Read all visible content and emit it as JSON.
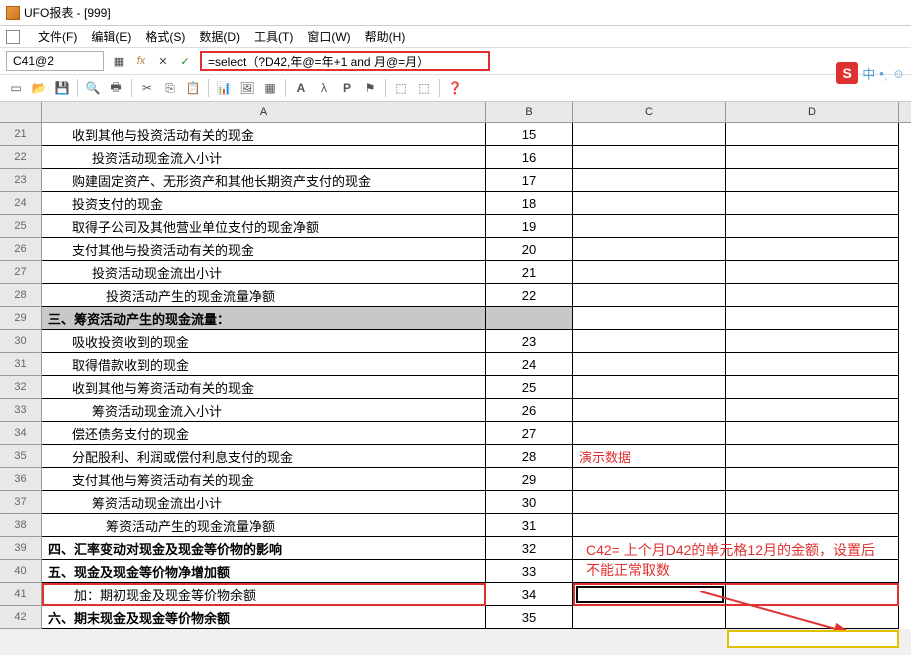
{
  "title": "UFO报表 - [999]",
  "menu": {
    "file": "文件(F)",
    "edit": "编辑(E)",
    "format": "格式(S)",
    "data": "数据(D)",
    "tool": "工具(T)",
    "window": "窗口(W)",
    "help": "帮助(H)"
  },
  "formula": {
    "cellref": "C41@2",
    "fx": "fx",
    "input": "=select（?D42,年@=年+1 and 月@=月）"
  },
  "columns": {
    "a": "A",
    "b": "B",
    "c": "C",
    "d": "D"
  },
  "rows": [
    {
      "num": "21",
      "a": "收到其他与投资活动有关的现金",
      "b": "15",
      "indent": 1
    },
    {
      "num": "22",
      "a": "投资活动现金流入小计",
      "b": "16",
      "indent": 2
    },
    {
      "num": "23",
      "a": "购建固定资产、无形资产和其他长期资产支付的现金",
      "b": "17",
      "indent": 1
    },
    {
      "num": "24",
      "a": "投资支付的现金",
      "b": "18",
      "indent": 1
    },
    {
      "num": "25",
      "a": "取得子公司及其他营业单位支付的现金净额",
      "b": "19",
      "indent": 1
    },
    {
      "num": "26",
      "a": "支付其他与投资活动有关的现金",
      "b": "20",
      "indent": 1
    },
    {
      "num": "27",
      "a": "投资活动现金流出小计",
      "b": "21",
      "indent": 2
    },
    {
      "num": "28",
      "a": "投资活动产生的现金流量净额",
      "b": "22",
      "indent": 3
    },
    {
      "num": "29",
      "a": "三、筹资活动产生的现金流量：",
      "b": "",
      "section": true
    },
    {
      "num": "30",
      "a": "吸收投资收到的现金",
      "b": "23",
      "indent": 1
    },
    {
      "num": "31",
      "a": "取得借款收到的现金",
      "b": "24",
      "indent": 1
    },
    {
      "num": "32",
      "a": "收到其他与筹资活动有关的现金",
      "b": "25",
      "indent": 1
    },
    {
      "num": "33",
      "a": "筹资活动现金流入小计",
      "b": "26",
      "indent": 2
    },
    {
      "num": "34",
      "a": "偿还债务支付的现金",
      "b": "27",
      "indent": 1
    },
    {
      "num": "35",
      "a": "分配股利、利润或偿付利息支付的现金",
      "b": "28",
      "indent": 1,
      "c": "演示数据",
      "cred": true
    },
    {
      "num": "36",
      "a": "支付其他与筹资活动有关的现金",
      "b": "29",
      "indent": 1
    },
    {
      "num": "37",
      "a": "筹资活动现金流出小计",
      "b": "30",
      "indent": 2
    },
    {
      "num": "38",
      "a": "筹资活动产生的现金流量净额",
      "b": "31",
      "indent": 3
    },
    {
      "num": "39",
      "a": "四、汇率变动对现金及现金等价物的影响",
      "b": "32",
      "bold": true
    },
    {
      "num": "40",
      "a": "五、现金及现金等价物净增加额",
      "b": "33",
      "bold": true
    },
    {
      "num": "41",
      "a": "加：期初现金及现金等价物余额",
      "b": "34",
      "indent": 1,
      "highlight": true
    },
    {
      "num": "42",
      "a": "六、期末现金及现金等价物余额",
      "b": "35",
      "bold": true
    }
  ],
  "annotation": "C42= 上个月D42的单元格12月的金额，设置后不能正常取数",
  "ime": {
    "s": "S",
    "label": "中",
    "dots": "•ˌ ☺"
  }
}
